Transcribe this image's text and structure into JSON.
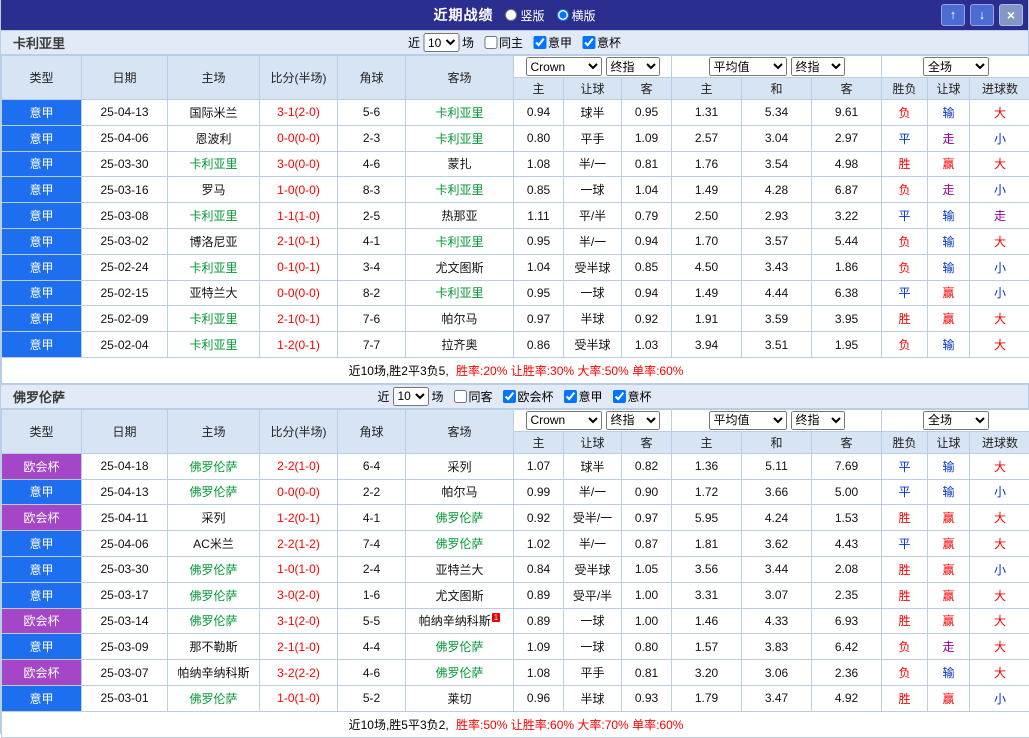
{
  "titlebar": {
    "title": "近期战绩",
    "layout_options": [
      {
        "label": "竖版",
        "selected": false
      },
      {
        "label": "横版",
        "selected": true
      }
    ],
    "buttons": {
      "up": "↑",
      "down": "↓",
      "close": "×"
    }
  },
  "columns": {
    "left": [
      "类型",
      "日期",
      "主场",
      "比分(半场)",
      "角球",
      "客场"
    ],
    "odds_group": {
      "selects": [
        "Crown",
        "终指"
      ],
      "sub": [
        "主",
        "让球",
        "客"
      ]
    },
    "avg_group": {
      "selects": [
        "平均值",
        "终指"
      ],
      "sub": [
        "主",
        "和",
        "客"
      ]
    },
    "result_group": {
      "selects": [
        "全场"
      ],
      "sub": [
        "胜负",
        "让球",
        "进球数"
      ]
    }
  },
  "league_colors": {
    "意甲": "#1d6ff0",
    "欧会杯": "#a546c8"
  },
  "result_colors": {
    "胜": "#ff0000",
    "负": "#ff0000",
    "平": "#0033cc",
    "赢": "#ff0000",
    "输": "#0033cc",
    "走": "#990099",
    "大": "#ff0000",
    "小": "#0033cc"
  },
  "team_color": "#009933",
  "score_color": "#ff0000",
  "sections": [
    {
      "team": "卡利亚里",
      "filters": {
        "prefix": "近",
        "count": "10",
        "suffix": "场",
        "checkboxes": [
          {
            "label": "同主",
            "checked": false
          },
          {
            "label": "意甲",
            "checked": true
          },
          {
            "label": "意杯",
            "checked": true
          }
        ]
      },
      "rows": [
        {
          "league": "意甲",
          "date": "25-04-13",
          "home": "国际米兰",
          "home_hl": false,
          "score": "3-1(2-0)",
          "corners": "5-6",
          "away": "卡利亚里",
          "away_hl": true,
          "odds": [
            "0.94",
            "球半",
            "0.95"
          ],
          "avg": [
            "1.31",
            "5.34",
            "9.61"
          ],
          "results": [
            "负",
            "输",
            "大"
          ]
        },
        {
          "league": "意甲",
          "date": "25-04-06",
          "home": "恩波利",
          "home_hl": false,
          "score": "0-0(0-0)",
          "corners": "2-3",
          "away": "卡利亚里",
          "away_hl": true,
          "odds": [
            "0.80",
            "平手",
            "1.09"
          ],
          "avg": [
            "2.57",
            "3.04",
            "2.97"
          ],
          "results": [
            "平",
            "走",
            "小"
          ]
        },
        {
          "league": "意甲",
          "date": "25-03-30",
          "home": "卡利亚里",
          "home_hl": true,
          "score": "3-0(0-0)",
          "corners": "4-6",
          "away": "蒙扎",
          "away_hl": false,
          "odds": [
            "1.08",
            "半/一",
            "0.81"
          ],
          "avg": [
            "1.76",
            "3.54",
            "4.98"
          ],
          "results": [
            "胜",
            "赢",
            "大"
          ]
        },
        {
          "league": "意甲",
          "date": "25-03-16",
          "home": "罗马",
          "home_hl": false,
          "score": "1-0(0-0)",
          "corners": "8-3",
          "away": "卡利亚里",
          "away_hl": true,
          "odds": [
            "0.85",
            "一球",
            "1.04"
          ],
          "avg": [
            "1.49",
            "4.28",
            "6.87"
          ],
          "results": [
            "负",
            "走",
            "小"
          ]
        },
        {
          "league": "意甲",
          "date": "25-03-08",
          "home": "卡利亚里",
          "home_hl": true,
          "score": "1-1(1-0)",
          "corners": "2-5",
          "away": "热那亚",
          "away_hl": false,
          "odds": [
            "1.11",
            "平/半",
            "0.79"
          ],
          "avg": [
            "2.50",
            "2.93",
            "3.22"
          ],
          "results": [
            "平",
            "输",
            "走"
          ]
        },
        {
          "league": "意甲",
          "date": "25-03-02",
          "home": "博洛尼亚",
          "home_hl": false,
          "score": "2-1(0-1)",
          "corners": "4-1",
          "away": "卡利亚里",
          "away_hl": true,
          "odds": [
            "0.95",
            "半/一",
            "0.94"
          ],
          "avg": [
            "1.70",
            "3.57",
            "5.44"
          ],
          "results": [
            "负",
            "输",
            "大"
          ]
        },
        {
          "league": "意甲",
          "date": "25-02-24",
          "home": "卡利亚里",
          "home_hl": true,
          "score": "0-1(0-1)",
          "corners": "3-4",
          "away": "尤文图斯",
          "away_hl": false,
          "odds": [
            "1.04",
            "受半球",
            "0.85"
          ],
          "avg": [
            "4.50",
            "3.43",
            "1.86"
          ],
          "results": [
            "负",
            "输",
            "小"
          ]
        },
        {
          "league": "意甲",
          "date": "25-02-15",
          "home": "亚特兰大",
          "home_hl": false,
          "score": "0-0(0-0)",
          "corners": "8-2",
          "away": "卡利亚里",
          "away_hl": true,
          "odds": [
            "0.95",
            "一球",
            "0.94"
          ],
          "avg": [
            "1.49",
            "4.44",
            "6.38"
          ],
          "results": [
            "平",
            "赢",
            "小"
          ]
        },
        {
          "league": "意甲",
          "date": "25-02-09",
          "home": "卡利亚里",
          "home_hl": true,
          "score": "2-1(0-1)",
          "corners": "7-6",
          "away": "帕尔马",
          "away_hl": false,
          "odds": [
            "0.97",
            "半球",
            "0.92"
          ],
          "avg": [
            "1.91",
            "3.59",
            "3.95"
          ],
          "results": [
            "胜",
            "赢",
            "大"
          ]
        },
        {
          "league": "意甲",
          "date": "25-02-04",
          "home": "卡利亚里",
          "home_hl": true,
          "score": "1-2(0-1)",
          "corners": "7-7",
          "away": "拉齐奥",
          "away_hl": false,
          "odds": [
            "0.86",
            "受半球",
            "1.03"
          ],
          "avg": [
            "3.94",
            "3.51",
            "1.95"
          ],
          "results": [
            "负",
            "输",
            "大"
          ]
        }
      ],
      "summary": {
        "record": "近10场,胜2平3负5,",
        "stats": "胜率:20% 让胜率:30% 大率:50% 单率:60%"
      }
    },
    {
      "team": "佛罗伦萨",
      "filters": {
        "prefix": "近",
        "count": "10",
        "suffix": "场",
        "checkboxes": [
          {
            "label": "同客",
            "checked": false
          },
          {
            "label": "欧会杯",
            "checked": true
          },
          {
            "label": "意甲",
            "checked": true
          },
          {
            "label": "意杯",
            "checked": true
          }
        ]
      },
      "rows": [
        {
          "league": "欧会杯",
          "date": "25-04-18",
          "home": "佛罗伦萨",
          "home_hl": true,
          "score": "2-2(1-0)",
          "corners": "6-4",
          "away": "采列",
          "away_hl": false,
          "odds": [
            "1.07",
            "球半",
            "0.82"
          ],
          "avg": [
            "1.36",
            "5.11",
            "7.69"
          ],
          "results": [
            "平",
            "输",
            "大"
          ]
        },
        {
          "league": "意甲",
          "date": "25-04-13",
          "home": "佛罗伦萨",
          "home_hl": true,
          "score": "0-0(0-0)",
          "corners": "2-2",
          "away": "帕尔马",
          "away_hl": false,
          "odds": [
            "0.99",
            "半/一",
            "0.90"
          ],
          "avg": [
            "1.72",
            "3.66",
            "5.00"
          ],
          "results": [
            "平",
            "输",
            "小"
          ]
        },
        {
          "league": "欧会杯",
          "date": "25-04-11",
          "home": "采列",
          "home_hl": false,
          "score": "1-2(0-1)",
          "corners": "4-1",
          "away": "佛罗伦萨",
          "away_hl": true,
          "odds": [
            "0.92",
            "受半/一",
            "0.97"
          ],
          "avg": [
            "5.95",
            "4.24",
            "1.53"
          ],
          "results": [
            "胜",
            "赢",
            "大"
          ]
        },
        {
          "league": "意甲",
          "date": "25-04-06",
          "home": "AC米兰",
          "home_hl": false,
          "score": "2-2(1-2)",
          "corners": "7-4",
          "away": "佛罗伦萨",
          "away_hl": true,
          "odds": [
            "1.02",
            "半/一",
            "0.87"
          ],
          "avg": [
            "1.81",
            "3.62",
            "4.43"
          ],
          "results": [
            "平",
            "赢",
            "大"
          ]
        },
        {
          "league": "意甲",
          "date": "25-03-30",
          "home": "佛罗伦萨",
          "home_hl": true,
          "score": "1-0(1-0)",
          "corners": "2-4",
          "away": "亚特兰大",
          "away_hl": false,
          "odds": [
            "0.84",
            "受半球",
            "1.05"
          ],
          "avg": [
            "3.56",
            "3.44",
            "2.08"
          ],
          "results": [
            "胜",
            "赢",
            "小"
          ]
        },
        {
          "league": "意甲",
          "date": "25-03-17",
          "home": "佛罗伦萨",
          "home_hl": true,
          "score": "3-0(2-0)",
          "corners": "1-6",
          "away": "尤文图斯",
          "away_hl": false,
          "odds": [
            "0.89",
            "受平/半",
            "1.00"
          ],
          "avg": [
            "3.31",
            "3.07",
            "2.35"
          ],
          "results": [
            "胜",
            "赢",
            "大"
          ]
        },
        {
          "league": "欧会杯",
          "date": "25-03-14",
          "home": "佛罗伦萨",
          "home_hl": true,
          "score": "3-1(2-0)",
          "corners": "5-5",
          "away": "帕纳辛纳科斯",
          "away_hl": false,
          "away_sup": "1",
          "odds": [
            "0.89",
            "一球",
            "1.00"
          ],
          "avg": [
            "1.46",
            "4.33",
            "6.93"
          ],
          "results": [
            "胜",
            "赢",
            "大"
          ]
        },
        {
          "league": "意甲",
          "date": "25-03-09",
          "home": "那不勒斯",
          "home_hl": false,
          "score": "2-1(1-0)",
          "corners": "4-4",
          "away": "佛罗伦萨",
          "away_hl": true,
          "odds": [
            "1.09",
            "一球",
            "0.80"
          ],
          "avg": [
            "1.57",
            "3.83",
            "6.42"
          ],
          "results": [
            "负",
            "走",
            "大"
          ]
        },
        {
          "league": "欧会杯",
          "date": "25-03-07",
          "home": "帕纳辛纳科斯",
          "home_hl": false,
          "score": "3-2(2-2)",
          "corners": "4-6",
          "away": "佛罗伦萨",
          "away_hl": true,
          "odds": [
            "1.08",
            "平手",
            "0.81"
          ],
          "avg": [
            "3.20",
            "3.06",
            "2.36"
          ],
          "results": [
            "负",
            "输",
            "大"
          ]
        },
        {
          "league": "意甲",
          "date": "25-03-01",
          "home": "佛罗伦萨",
          "home_hl": true,
          "score": "1-0(1-0)",
          "corners": "5-2",
          "away": "莱切",
          "away_hl": false,
          "odds": [
            "0.96",
            "半球",
            "0.93"
          ],
          "avg": [
            "1.79",
            "3.47",
            "4.92"
          ],
          "results": [
            "胜",
            "赢",
            "小"
          ]
        }
      ],
      "summary": {
        "record": "近10场,胜5平3负2,",
        "stats": "胜率:50% 让胜率:60% 大率:70% 单率:60%"
      }
    }
  ]
}
